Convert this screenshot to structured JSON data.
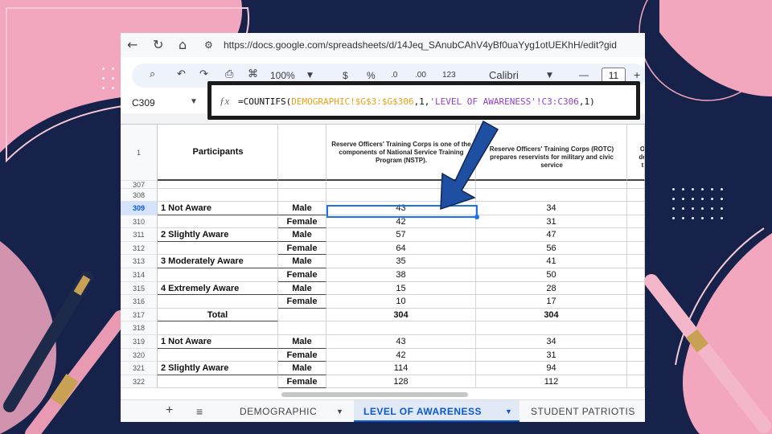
{
  "browser": {
    "url": "https://docs.google.com/spreadsheets/d/14Jeq_SAnubCAhV4yBf0uaYyg1otUEKhH/edit?gid"
  },
  "toolbar": {
    "zoom": "100%",
    "currency": "$",
    "percent": "%",
    "dec_decrease": ".0",
    "dec_increase": ".00",
    "number_format": "123",
    "font": "Calibri",
    "font_minus": "—",
    "font_size": "11",
    "font_plus": "+"
  },
  "formula_bar": {
    "name_box": "C309",
    "fx": "fx",
    "prefix": "=COUNTIFS(",
    "range1": "DEMOGRAPHIC!$G$3:$G$306",
    "mid": ",1,",
    "range2": "'LEVEL OF AWARENESS'!C3:C306",
    "suffix": ",1)"
  },
  "header_row": {
    "row_number": "1",
    "participants": "Participants",
    "col_c": "Reserve Officers' Training Corps is one of the components of National Service Training Program (NSTP).",
    "col_d": "Reserve Officers' Training Corps (ROTC) prepares reservists for military and civic service",
    "col_e": "O de t"
  },
  "rows": [
    {
      "n": "307",
      "name": "",
      "sex": "",
      "c": "",
      "d": ""
    },
    {
      "n": "308",
      "name": "",
      "sex": "",
      "c": "",
      "d": ""
    },
    {
      "n": "309",
      "name": "1 Not Aware",
      "sex": "Male",
      "c": "43",
      "d": "34"
    },
    {
      "n": "310",
      "name": "",
      "sex": "Female",
      "c": "42",
      "d": "31"
    },
    {
      "n": "311",
      "name": "2 Slightly Aware",
      "sex": "Male",
      "c": "57",
      "d": "47"
    },
    {
      "n": "312",
      "name": "",
      "sex": "Female",
      "c": "64",
      "d": "56"
    },
    {
      "n": "313",
      "name": "3 Moderately Aware",
      "sex": "Male",
      "c": "35",
      "d": "41"
    },
    {
      "n": "314",
      "name": "",
      "sex": "Female",
      "c": "38",
      "d": "50"
    },
    {
      "n": "315",
      "name": "4 Extremely Aware",
      "sex": "Male",
      "c": "15",
      "d": "28"
    },
    {
      "n": "316",
      "name": "",
      "sex": "Female",
      "c": "10",
      "d": "17"
    },
    {
      "n": "317",
      "name": "Total",
      "sex": "",
      "c": "304",
      "d": "304"
    },
    {
      "n": "318",
      "name": "",
      "sex": "",
      "c": "",
      "d": ""
    },
    {
      "n": "319",
      "name": "1 Not Aware",
      "sex": "Male",
      "c": "43",
      "d": "34"
    },
    {
      "n": "320",
      "name": "",
      "sex": "Female",
      "c": "42",
      "d": "31"
    },
    {
      "n": "321",
      "name": "2 Slightly Aware",
      "sex": "Male",
      "c": "114",
      "d": "94"
    },
    {
      "n": "322",
      "name": "",
      "sex": "Female",
      "c": "128",
      "d": "112"
    }
  ],
  "sheet_tabs": {
    "tab1": "DEMOGRAPHIC",
    "tab2": "LEVEL OF AWARENESS",
    "tab3": "STUDENT PATRIOTIS"
  },
  "colors": {
    "background": "#16224a",
    "accent_pink": "#f2a7bf",
    "arrow": "#1f4fa3",
    "selection": "#1a73e8"
  }
}
